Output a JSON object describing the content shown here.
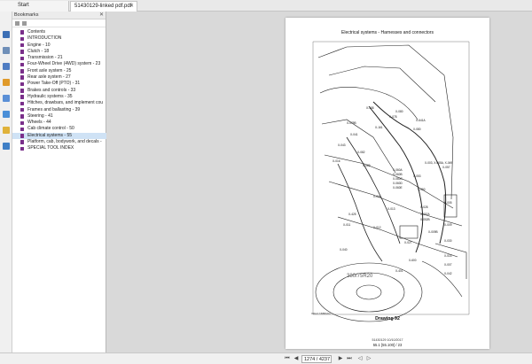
{
  "tabs": {
    "start": "Start",
    "document": "51430129-linked pdf.pdf"
  },
  "bookmarks": {
    "title": "Bookmarks",
    "items": [
      "Contents",
      "INTRODUCTION",
      "Engine - 10",
      "Clutch - 18",
      "Transmission - 21",
      "Four-Wheel Drive (4WD) system - 23",
      "Front axle system - 25",
      "Rear axle system - 27",
      "Power Take-Off (PTO) - 31",
      "Brakes and controls - 33",
      "Hydraulic systems - 35",
      "Hitches, drawbars, and implement cou",
      "Frames and ballasting - 39",
      "Steering - 41",
      "Wheels - 44",
      "Cab climate control - 50",
      "Electrical systems - 55",
      "Platform, cab, bodywork, and decals -",
      "SPECIAL TOOL INDEX"
    ],
    "active_index": 16
  },
  "page": {
    "header": "Electrical systems - Harnesses and connectors",
    "figure_id": "ORH/17/B8B9/04",
    "drawing_caption": "Drawing 92",
    "footer_line1": "51430129 10/10/2017",
    "footer_line2": "55.1 [55.100] / 23",
    "connector_labels": [
      "X-158",
      "X-080",
      "X-078",
      "X-641A",
      "X-079B",
      "X-161",
      "X-080",
      "X-041",
      "X-043",
      "X-082",
      "X-016",
      "X-083",
      "X-060A",
      "X-060B",
      "X-060C",
      "X-060D",
      "X-060E",
      "X-003, X-005A, X-049",
      "X-053",
      "X-057",
      "X-050",
      "X-004",
      "X-028",
      "X-013",
      "X-425",
      "X-011",
      "X-012",
      "X-052A",
      "X-052B",
      "X-005",
      "X-009",
      "X-009B",
      "X-030",
      "X-014",
      "X-007",
      "X-040",
      "X-042",
      "X-401",
      "X-600",
      "X-027"
    ],
    "tire_text": "380/75R20"
  },
  "navigation": {
    "page_value": "1274 / 4237"
  }
}
